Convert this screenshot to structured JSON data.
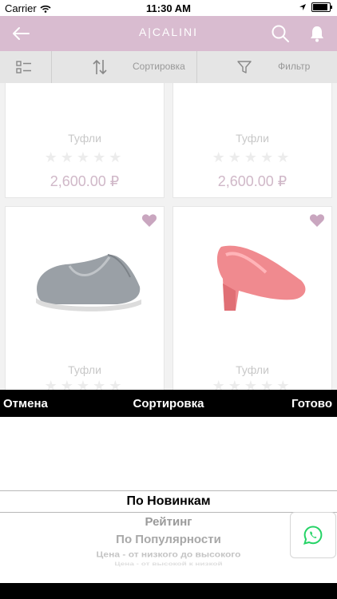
{
  "status_bar": {
    "carrier": "Carrier",
    "time": "11:30 AM"
  },
  "navbar": {
    "logo_text": "A|CALINI",
    "back_icon": "arrow-left-icon",
    "search_icon": "search-icon",
    "bell_icon": "bell-icon"
  },
  "toolbar": {
    "sort_label": "Сортировка",
    "filter_label": "Фильтр"
  },
  "products": [
    {
      "name": "Туфли",
      "price": "2,600.00 ₽",
      "rating": 0
    },
    {
      "name": "Туфли",
      "price": "2,600.00 ₽",
      "rating": 0
    },
    {
      "name": "Туфли",
      "image": "grey-slip-on-shoe"
    },
    {
      "name": "Туфли",
      "image": "pink-pump-shoe"
    }
  ],
  "picker": {
    "cancel_label": "Отмена",
    "title": "Сортировка",
    "done_label": "Готово",
    "options": [
      "По Новинкам",
      "Рейтинг",
      "По Популярности",
      "Цена - от низкого до высокого",
      "Цена - от высокой к низкой"
    ]
  },
  "colors": {
    "brand": "#d9bcd0",
    "heart": "#c9a6bf",
    "whatsapp": "#25d366"
  }
}
